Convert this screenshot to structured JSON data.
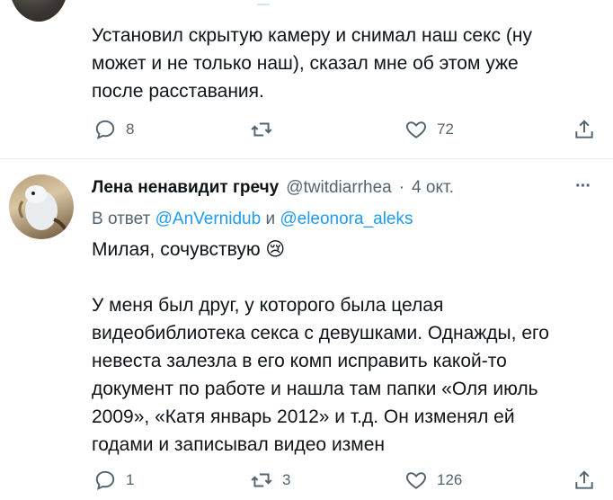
{
  "tweet_top": {
    "text": "Установил скрытую камеру и снимал наш секс (ну может и не только наш), сказал мне об этом уже после расставания.",
    "reply_count": "8",
    "retweet_count": "",
    "like_count": "72"
  },
  "tweet_reply": {
    "display_name": "Лена ненавидит гречу",
    "handle": "@twitdiarrhea",
    "separator": "·",
    "date": "4 окт.",
    "more": "···",
    "reply_to_prefix": "В ответ",
    "reply_to_user1": "@AnVernidub",
    "reply_to_and": "и",
    "reply_to_user2": "@eleonora_aleks",
    "text_line1": "Милая, сочувствую",
    "emoji": "😢",
    "text_para2": "У меня был друг, у которого была целая видеобиблиотека секса с девушками. Однажды, его невеста залезла в его комп исправить какой-то документ по работе и нашла там папки «Оля июль 2009», «Катя январь 2012» и т.д. Он изменял ей годами и записывал видео измен",
    "reply_count": "1",
    "retweet_count": "3",
    "like_count": "126"
  },
  "icons": [
    "reply-icon",
    "retweet-icon",
    "like-icon",
    "share-icon",
    "avatar"
  ]
}
